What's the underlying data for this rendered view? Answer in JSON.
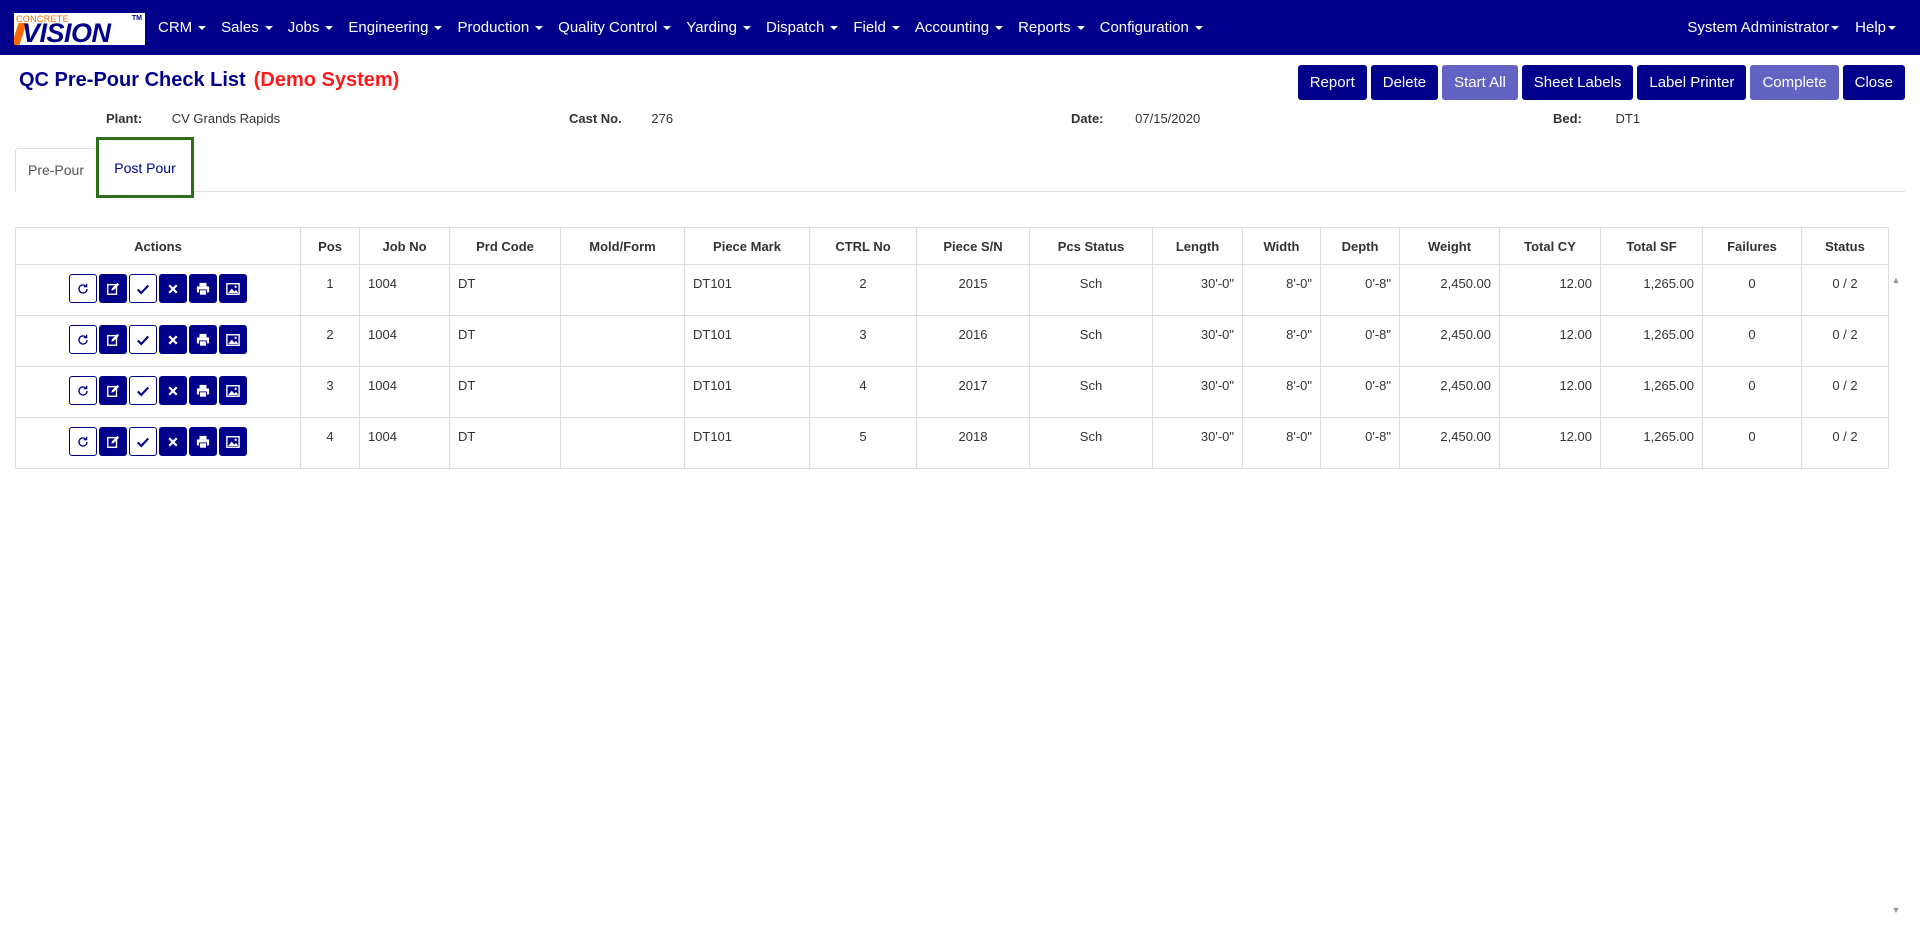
{
  "app": {
    "logo_top": "CONCRETE",
    "logo_main": "VISION",
    "logo_tm": "TM"
  },
  "nav": {
    "items": [
      {
        "label": "CRM"
      },
      {
        "label": "Sales"
      },
      {
        "label": "Jobs"
      },
      {
        "label": "Engineering"
      },
      {
        "label": "Production"
      },
      {
        "label": "Quality Control"
      },
      {
        "label": "Yarding"
      },
      {
        "label": "Dispatch"
      },
      {
        "label": "Field"
      },
      {
        "label": "Accounting"
      },
      {
        "label": "Reports"
      },
      {
        "label": "Configuration"
      }
    ],
    "user": "System Administrator",
    "help": "Help"
  },
  "page": {
    "title": "QC Pre-Pour Check List",
    "demo": "(Demo System)"
  },
  "toolbar": {
    "report": "Report",
    "delete": "Delete",
    "start_all": "Start All",
    "sheet_labels": "Sheet Labels",
    "label_printer": "Label Printer",
    "complete": "Complete",
    "close": "Close"
  },
  "info": {
    "plant_label": "Plant:",
    "plant_value": "CV Grands Rapids",
    "cast_label": "Cast No.",
    "cast_value": "276",
    "date_label": "Date:",
    "date_value": "07/15/2020",
    "bed_label": "Bed:",
    "bed_value": "DT1"
  },
  "tabs": {
    "prepour": "Pre-Pour",
    "postpour": "Post Pour"
  },
  "table": {
    "headers": [
      "Actions",
      "Pos",
      "Job No",
      "Prd Code",
      "Mold/Form",
      "Piece Mark",
      "CTRL No",
      "Piece S/N",
      "Pcs Status",
      "Length",
      "Width",
      "Depth",
      "Weight",
      "Total CY",
      "Total SF",
      "Failures",
      "Status"
    ],
    "rows": [
      {
        "pos": "1",
        "job": "1004",
        "prd": "DT",
        "mold": "",
        "mark": "DT101",
        "ctrl": "2",
        "sn": "2015",
        "pcs_status": "Sch",
        "length": "30'-0\"",
        "width": "8'-0\"",
        "depth": "0'-8\"",
        "weight": "2,450.00",
        "cy": "12.00",
        "sf": "1,265.00",
        "failures": "0",
        "status": "0 / 2"
      },
      {
        "pos": "2",
        "job": "1004",
        "prd": "DT",
        "mold": "",
        "mark": "DT101",
        "ctrl": "3",
        "sn": "2016",
        "pcs_status": "Sch",
        "length": "30'-0\"",
        "width": "8'-0\"",
        "depth": "0'-8\"",
        "weight": "2,450.00",
        "cy": "12.00",
        "sf": "1,265.00",
        "failures": "0",
        "status": "0 / 2"
      },
      {
        "pos": "3",
        "job": "1004",
        "prd": "DT",
        "mold": "",
        "mark": "DT101",
        "ctrl": "4",
        "sn": "2017",
        "pcs_status": "Sch",
        "length": "30'-0\"",
        "width": "8'-0\"",
        "depth": "0'-8\"",
        "weight": "2,450.00",
        "cy": "12.00",
        "sf": "1,265.00",
        "failures": "0",
        "status": "0 / 2"
      },
      {
        "pos": "4",
        "job": "1004",
        "prd": "DT",
        "mold": "",
        "mark": "DT101",
        "ctrl": "5",
        "sn": "2018",
        "pcs_status": "Sch",
        "length": "30'-0\"",
        "width": "8'-0\"",
        "depth": "0'-8\"",
        "weight": "2,450.00",
        "cy": "12.00",
        "sf": "1,265.00",
        "failures": "0",
        "status": "0 / 2"
      }
    ],
    "row_actions": [
      "refresh-icon",
      "edit-icon",
      "check-icon",
      "close-icon",
      "print-icon",
      "image-icon"
    ]
  },
  "colors": {
    "navbar": "#00008b",
    "primary_button": "#00008b",
    "disabled_button": "#6363c4",
    "demo_text": "#ff1a1a",
    "tab_highlight": "#2d6e1a"
  }
}
